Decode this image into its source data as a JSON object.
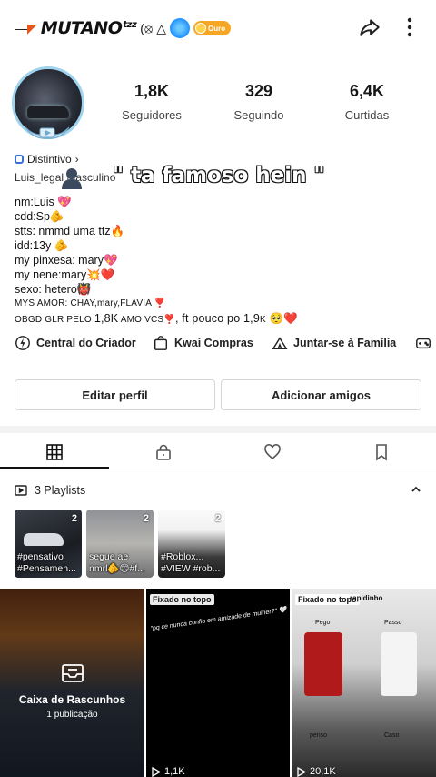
{
  "header": {
    "username": "MUTANO",
    "username_sup": "tzz",
    "level_label": "Ouro"
  },
  "stats": [
    {
      "value": "1,8K",
      "label": "Seguidores"
    },
    {
      "value": "329",
      "label": "Seguindo"
    },
    {
      "value": "6,4K",
      "label": "Curtidas"
    }
  ],
  "profile": {
    "distintivo": "Distintivo",
    "meta": "Luis_legal      Masculino",
    "overlay_caption": "\" ta famoso hein \"",
    "bio_lines": [
      "nm:Luis 💖",
      "cdd:Sp🫵",
      "stts: nmmd uma ttz🔥",
      "idd:13y 🫵",
      "my pinxesa: mary💖",
      "my nene:mary💥❤️",
      "sexo: hetero👹"
    ],
    "bio_small_1": "MYS AMOR: CHAY,mary,FLAVIA ❣️",
    "bio_small_2a": "OBGD GLR PELO ",
    "bio_small_2b": "1,8K",
    "bio_small_2c": " AMO VCS❣️",
    "bio_small_2d": ", ft pouco po 1,9",
    "bio_small_2e": "K",
    "bio_small_2f": " 🥺❤️"
  },
  "actions": [
    {
      "label": "Central do Criador"
    },
    {
      "label": "Kwai Compras"
    },
    {
      "label": "Juntar-se à Família"
    }
  ],
  "buttons": {
    "edit_profile": "Editar perfil",
    "add_friends": "Adicionar amigos"
  },
  "playlists": {
    "title": "3 Playlists",
    "items": [
      {
        "count": "2",
        "caption_1": "#pensativo",
        "caption_2": "#Pensamen..."
      },
      {
        "count": "2",
        "caption_1": "segue ae",
        "caption_2": "nmrl🫵😊#f..."
      },
      {
        "count": "2",
        "caption_1": "#Roblox...",
        "caption_2": "#VIEW #rob..."
      }
    ]
  },
  "grid": {
    "drafts_title": "Caixa de Rascunhos",
    "drafts_sub": "1 publicação",
    "pinned_label": "Fixado no topo",
    "cell2_caption": "\"pq ce nunca confio em amizade de mulher?\" 🤍",
    "cell2_views": "1,1K",
    "cell3_views": "20,1K",
    "cell3_top": "rapidinho",
    "cell3_pego": "Pego",
    "cell3_passo": "Passo",
    "cell3_penso": "penso",
    "cell3_caso": "Caso"
  }
}
